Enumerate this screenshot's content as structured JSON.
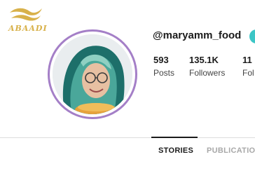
{
  "brand": {
    "logo_text": "ABAADI",
    "logo_color": "#d8b14a"
  },
  "profile": {
    "username": "@maryamm_food",
    "avatar_alt": "profile photo",
    "ring_color": "#a47fc7",
    "action_color": "#3cc6c6"
  },
  "stats": [
    {
      "value": "593",
      "label": "Posts"
    },
    {
      "value": "135.1K",
      "label": "Followers"
    },
    {
      "value": "11",
      "label": "Fol"
    }
  ],
  "tabs": [
    {
      "label": "STORIES",
      "active": true
    },
    {
      "label": "PUBLICATIO",
      "active": false
    }
  ]
}
